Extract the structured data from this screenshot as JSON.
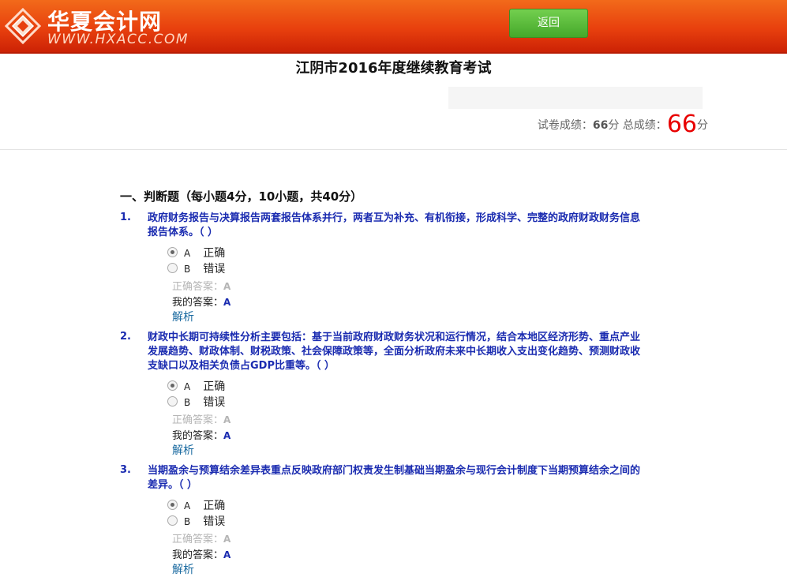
{
  "header": {
    "logo_cn": "华夏会计网",
    "logo_url": "WWW.HXACC.COM",
    "back_label": "返回"
  },
  "exam": {
    "title": "江阴市2016年度继续教育考试",
    "paper_score_label": "试卷成绩：",
    "paper_score": "66",
    "paper_score_unit": "分",
    "total_score_label": "总成绩：",
    "total_score": "66",
    "total_score_unit": "分"
  },
  "section": {
    "title": "一、判断题（每小题4分，10小题，共40分）"
  },
  "labels": {
    "correct_answer": "正确答案：",
    "my_answer": "我的答案：",
    "analysis": "解析"
  },
  "questions": [
    {
      "num": "1.",
      "text": "政府财务报告与决算报告两套报告体系并行，两者互为补充、有机衔接，形成科学、完整的政府财政财务信息报告体系。（ ）",
      "options": [
        {
          "letter": "A",
          "text": "正确",
          "selected": true
        },
        {
          "letter": "B",
          "text": "错误",
          "selected": false
        }
      ],
      "correct": "A",
      "mine": "A"
    },
    {
      "num": "2.",
      "text": "财政中长期可持续性分析主要包括：基于当前政府财政财务状况和运行情况，结合本地区经济形势、重点产业发展趋势、财政体制、财税政策、社会保障政策等，全面分析政府未来中长期收入支出变化趋势、预测财政收支缺口以及相关负债占GDP比重等。（ ）",
      "options": [
        {
          "letter": "A",
          "text": "正确",
          "selected": true
        },
        {
          "letter": "B",
          "text": "错误",
          "selected": false
        }
      ],
      "correct": "A",
      "mine": "A"
    },
    {
      "num": "3.",
      "text": "当期盈余与预算结余差异表重点反映政府部门权责发生制基础当期盈余与现行会计制度下当期预算结余之间的差异。（ ）",
      "options": [
        {
          "letter": "A",
          "text": "正确",
          "selected": true
        },
        {
          "letter": "B",
          "text": "错误",
          "selected": false
        }
      ],
      "correct": "A",
      "mine": "A"
    }
  ]
}
